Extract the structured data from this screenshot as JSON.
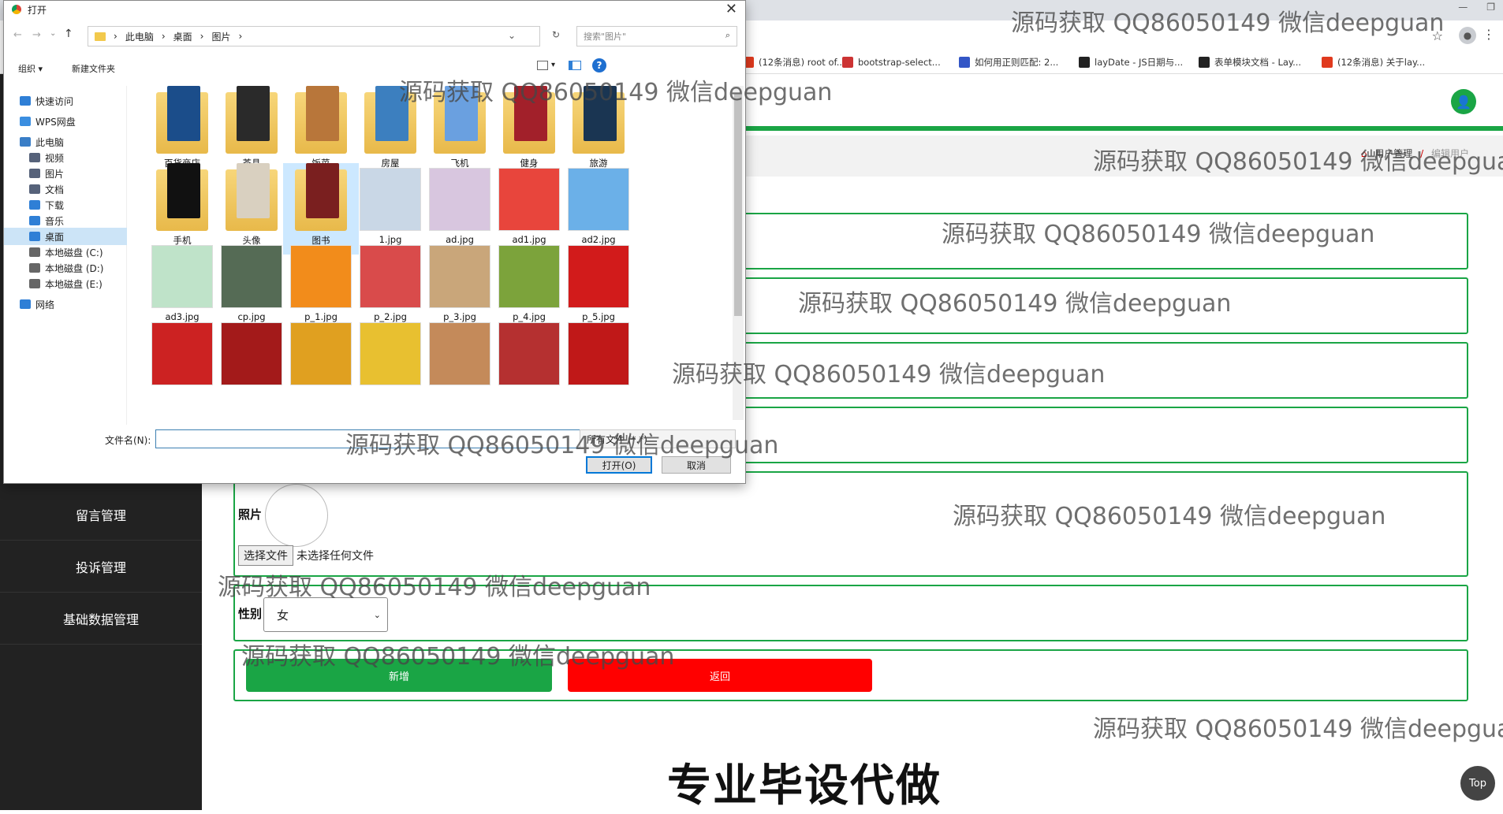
{
  "browser": {
    "bookmarks": [
      {
        "label": "(12条消息) root of...",
        "icon": "csdn-icon",
        "color": "#e03a1e"
      },
      {
        "label": "bootstrap-select...",
        "icon": "bootstrap-icon",
        "color": "#c33"
      },
      {
        "label": "如何用正则匹配: 2...",
        "icon": "pinwheel-icon",
        "color": "#3356c6"
      },
      {
        "label": "layDate - JS日期与...",
        "icon": "layui-icon",
        "color": "#222"
      },
      {
        "label": "表单模块文档 - Lay...",
        "icon": "layui-icon",
        "color": "#222"
      },
      {
        "label": "(12条消息) 关于lay...",
        "icon": "csdn-icon",
        "color": "#e03a1e"
      }
    ]
  },
  "breadcrumb": {
    "item1": "用户管理",
    "sep": "/",
    "item2": "编辑用户"
  },
  "sidebar": {
    "items": [
      "留言管理",
      "投诉管理",
      "基础数据管理"
    ]
  },
  "form": {
    "photo_label": "照片",
    "file_button": "选择文件",
    "file_status": "未选择任何文件",
    "gender_label": "性别",
    "gender_value": "女",
    "add_button": "新增",
    "back_button": "返回"
  },
  "overlay_text": "专业毕设代做",
  "top_button": "Top",
  "dialog": {
    "title": "打开",
    "path": [
      "此电脑",
      "桌面",
      "图片"
    ],
    "search_placeholder": "搜索\"图片\"",
    "organize": "组织 ▾",
    "new_folder": "新建文件夹",
    "nav": [
      {
        "label": "快速访问",
        "icon": "star-icon",
        "color": "#2f7fd6"
      },
      {
        "label": "WPS网盘",
        "icon": "cloud-icon",
        "color": "#3b8ee0"
      },
      {
        "label": "此电脑",
        "icon": "computer-icon",
        "color": "#3a7ec7"
      },
      {
        "label": "视频",
        "icon": "video-icon",
        "color": "#56627a"
      },
      {
        "label": "图片",
        "icon": "picture-icon",
        "color": "#56627a"
      },
      {
        "label": "文档",
        "icon": "document-icon",
        "color": "#56627a"
      },
      {
        "label": "下载",
        "icon": "download-icon",
        "color": "#2f7fd6"
      },
      {
        "label": "音乐",
        "icon": "music-icon",
        "color": "#2f7fd6"
      },
      {
        "label": "桌面",
        "icon": "desktop-icon",
        "color": "#2f7fd6"
      },
      {
        "label": "本地磁盘 (C:)",
        "icon": "disk-icon",
        "color": "#666"
      },
      {
        "label": "本地磁盘 (D:)",
        "icon": "disk-icon",
        "color": "#666"
      },
      {
        "label": "本地磁盘 (E:)",
        "icon": "disk-icon",
        "color": "#666"
      },
      {
        "label": "网络",
        "icon": "network-icon",
        "color": "#2f7fd6"
      }
    ],
    "files_row1": [
      "百货商店",
      "茶具",
      "饭菜",
      "房屋",
      "飞机",
      "健身",
      "旅游"
    ],
    "files_row2": [
      "手机",
      "头像",
      "图书",
      "1.jpg",
      "ad.jpg",
      "ad1.jpg",
      "ad2.jpg"
    ],
    "files_row3": [
      "ad3.jpg",
      "cp.jpg",
      "p_1.jpg",
      "p_2.jpg",
      "p_3.jpg",
      "p_4.jpg",
      "p_5.jpg"
    ],
    "filename_label": "文件名(N):",
    "filetype": "所有文件 (*.*)",
    "open_button": "打开(O)",
    "cancel_button": "取消"
  },
  "watermark": "源码获取 QQ86050149 微信deepguan"
}
